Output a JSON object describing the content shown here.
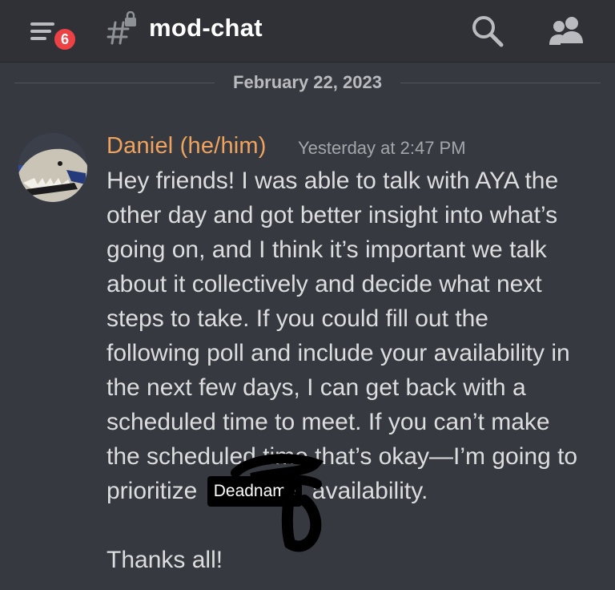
{
  "header": {
    "menu_icon": "hamburger-menu-icon",
    "unread_badge": "6",
    "channel_icon": "hashtag-lock-icon",
    "channel_name": "mod-chat",
    "search_icon": "search-icon",
    "members_icon": "members-icon"
  },
  "divider": {
    "date": "February 22, 2023"
  },
  "message": {
    "author": "Daniel (he/him)",
    "timestamp": "Yesterday at 2:47 PM",
    "lines": [
      "Hey friends! I was able to talk with AYA the",
      "other day and got better insight into what’s",
      "going on, and I think it’s important we talk",
      "about it collectively and decide what next",
      "steps to take. If you could fill out the",
      "following poll and include your availability in",
      "the next few days, I can get back with a",
      "scheduled time to meet. If you can’t make",
      "the scheduled time that’s okay—I’m going to"
    ],
    "last_line_before": "prioritize",
    "redaction_label": "Deadname",
    "last_line_after": "availability.",
    "closing": "Thanks all!"
  },
  "colors": {
    "background": "#36393f",
    "header": "#2f3136",
    "author_color": "#f0a35e",
    "badge": "#ed4245"
  }
}
